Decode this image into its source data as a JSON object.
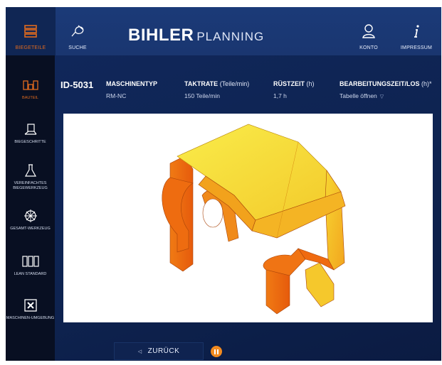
{
  "topbar": {
    "nav": [
      {
        "label": "BIEGETEILE",
        "icon": "bending-parts-icon"
      },
      {
        "label": "SUCHE",
        "icon": "search-icon"
      },
      {
        "label": "KONTO",
        "icon": "user-icon"
      },
      {
        "label": "IMPRESSUM",
        "icon": "info-icon"
      }
    ],
    "brand_bold": "BIHLER",
    "brand_light": "PLANNING"
  },
  "sidebar": {
    "items": [
      {
        "label": "BAUTEIL",
        "icon": "component-icon",
        "active": true
      },
      {
        "label": "BIEGESCHRITTE",
        "icon": "bending-steps-icon"
      },
      {
        "label": "VEREINFACHTES BIEGEWERKZEUG",
        "icon": "flask-icon"
      },
      {
        "label": "GESAMT-WERKZEUG",
        "icon": "total-tool-icon"
      },
      {
        "label": "LEAN STANDARD",
        "icon": "lean-standard-icon"
      },
      {
        "label": "MASCHINEN-UMGEBUNG",
        "icon": "machine-environment-icon"
      }
    ]
  },
  "header": {
    "part_id": "ID-5031",
    "machine_type": {
      "title": "MASCHINENTYP",
      "value": "RM-NC"
    },
    "cycle_rate": {
      "title": "TAKTRATE",
      "unit": "(Teile/min)",
      "value": "150 Teile/min"
    },
    "setup_time": {
      "title": "RÜSTZEIT",
      "unit": "(h)",
      "value": "1,7 h"
    },
    "processing_time": {
      "title": "BEARBEITUNGSZEIT/LOS",
      "unit": "(h)*",
      "value": "Tabelle öffnen"
    }
  },
  "footer": {
    "back_label": "ZURÜCK",
    "pause_icon": "pause-icon"
  },
  "colors": {
    "accent": "#e06a1e",
    "pause": "#f28a1f",
    "part_light": "#f7e43a",
    "part_dark": "#e8600f"
  }
}
